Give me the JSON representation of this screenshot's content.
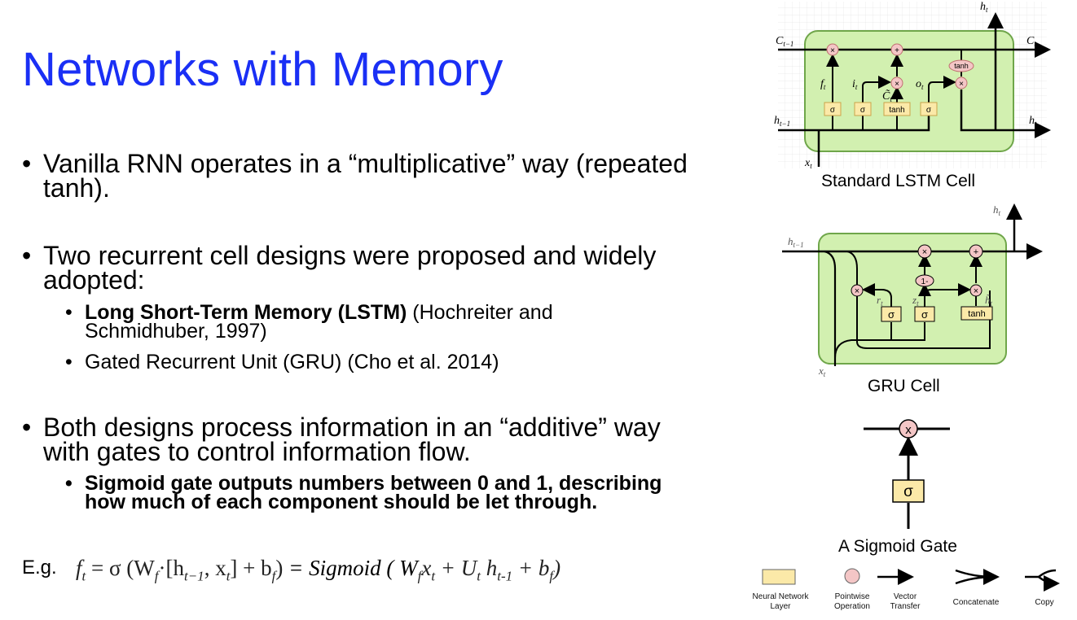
{
  "title": "Networks with Memory",
  "bullets": {
    "b1_line1": "Vanilla RNN operates in a “multiplicative” way (repeated",
    "b1_line2": "tanh).",
    "b2_line1": "Two recurrent cell designs were proposed and widely",
    "b2_line2": "adopted:",
    "b2_sub1_bold": "Long Short-Term Memory (LSTM)",
    "b2_sub1_rest": " (Hochreiter and",
    "b2_sub1_line2": "Schmidhuber, 1997)",
    "b2_sub2": "Gated Recurrent Unit (GRU) (Cho et al. 2014)",
    "b3_line1": "Both designs process information in an “additive” way",
    "b3_line2": "with gates to control information flow.",
    "b3_sub1_line1": "Sigmoid gate outputs numbers between 0 and 1, describing",
    "b3_sub1_line2": "how much of each component should be let through."
  },
  "equation": {
    "label": "E.g.",
    "lhs": "f",
    "lhs_sub": "t",
    "eq1": " = σ (W",
    "eq1_sub": "f",
    "eq1_rest": "·[h",
    "eq1_rest_sub": "t−1",
    "eq1_rest2": ", x",
    "eq1_rest2_sub": "t",
    "eq1_close": "]  +  b",
    "eq1_close_sub": "f",
    "eq1_end": ")",
    "eq2": " = Sigmoid ( W",
    "eq2_sub1": "f",
    "eq2_x": "x",
    "eq2_sub2": "t",
    "eq2_plus": " + U",
    "eq2_sub3": "t",
    "eq2_h": " h",
    "eq2_sub4": "t-1",
    "eq2_b": " + b",
    "eq2_sub5": "f",
    "eq2_end": ")"
  },
  "lstm": {
    "caption": "Standard LSTM Cell",
    "labels": {
      "c_prev": "C",
      "c_prev_sub": "t−1",
      "c_next": "C",
      "c_next_sub": "t",
      "h_top": "h",
      "h_top_sub": "t",
      "h_prev": "h",
      "h_prev_sub": "t−1",
      "h_out": "h",
      "h_out_sub": "t",
      "x": "x",
      "x_sub": "t",
      "f": "f",
      "f_sub": "t",
      "i": "i",
      "i_sub": "t",
      "c_tilde": "C̃",
      "c_tilde_sub": "t",
      "o": "o",
      "o_sub": "t"
    },
    "gates": [
      "σ",
      "σ",
      "tanh",
      "σ"
    ],
    "ops": {
      "mul": "×",
      "add": "+",
      "tanh": "tanh"
    }
  },
  "gru": {
    "caption": "GRU Cell",
    "labels": {
      "h_top": "h",
      "h_top_sub": "t",
      "h_prev": "h",
      "h_prev_sub": "t−1",
      "x": "x",
      "x_sub": "t",
      "r": "r",
      "r_sub": "t",
      "z": "z",
      "z_sub": "t",
      "htilde": "h̃",
      "htilde_sub": "t"
    },
    "gates": [
      "σ",
      "σ",
      "tanh"
    ],
    "ops": {
      "mul": "×",
      "add": "+",
      "one_minus": "1-"
    }
  },
  "sigmoid_gate": {
    "caption": "A Sigmoid Gate",
    "gate": "σ",
    "op": "x"
  },
  "legend": {
    "nn_layer": [
      "Neural Network",
      "Layer"
    ],
    "pointwise": [
      "Pointwise",
      "Operation"
    ],
    "vector": [
      "Vector",
      "Transfer"
    ],
    "concat": "Concatenate",
    "copy": "Copy"
  },
  "colors": {
    "title": "#1a2ff5",
    "cell_fill": "#d2f0b0",
    "cell_stroke": "#6fa64a",
    "gate_fill": "#fbe9a8",
    "gate_stroke": "#c9a34a",
    "op_fill": "#f4c6c6",
    "op_stroke": "#c07070"
  }
}
